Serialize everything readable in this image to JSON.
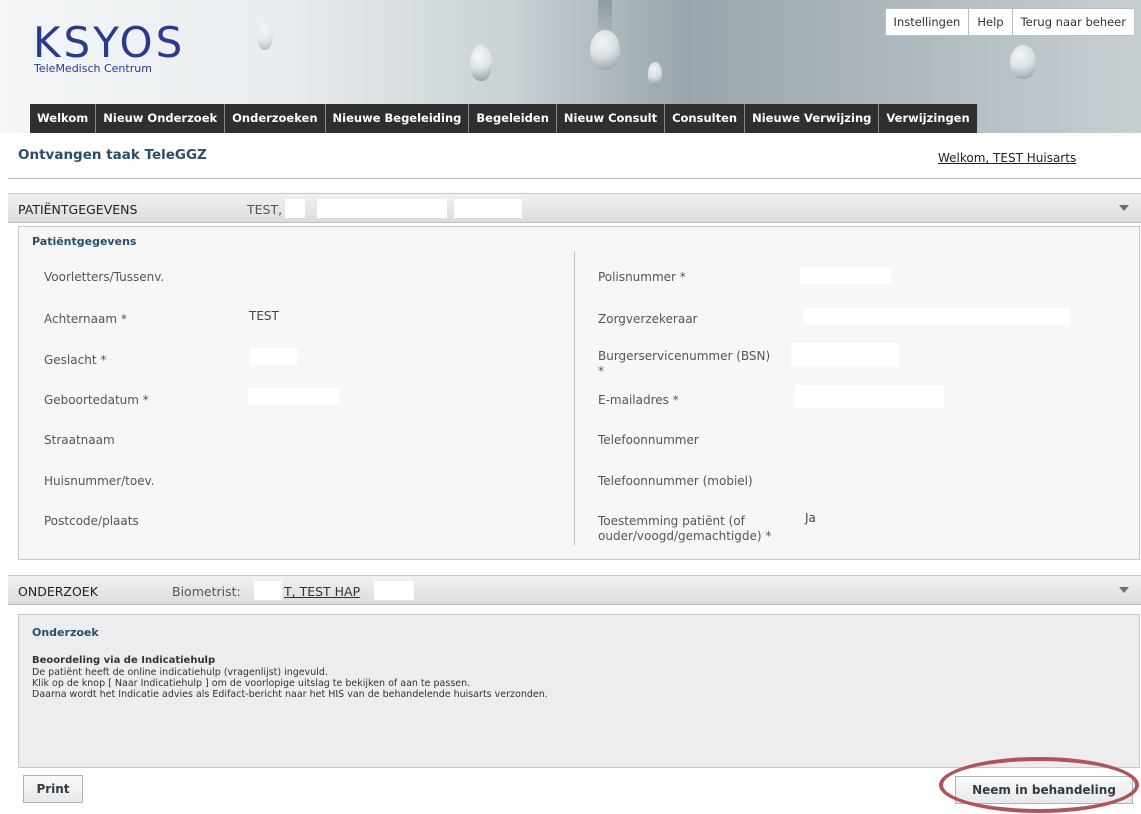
{
  "header": {
    "logo": {
      "main": "KSYOS",
      "sub": "TeleMedisch Centrum"
    },
    "top_links": [
      "Instellingen",
      "Help",
      "Terug naar beheer"
    ]
  },
  "nav": {
    "items": [
      "Welkom",
      "Nieuw Onderzoek",
      "Onderzoeken",
      "Nieuwe Begeleiding",
      "Begeleiden",
      "Nieuw Consult",
      "Consulten",
      "Nieuwe Verwijzing",
      "Verwijzingen"
    ]
  },
  "page": {
    "title": "Ontvangen taak TeleGGZ",
    "welcome": "Welkom, TEST Huisarts"
  },
  "patient_section": {
    "bar_title": "PATIËNTGEGEVENS",
    "bar_name": "TEST,",
    "heading": "Patiëntgegevens",
    "left_fields": [
      {
        "label": "Voorletters/Tussenv.",
        "value": ""
      },
      {
        "label": "Achternaam *",
        "value": "TEST"
      },
      {
        "label": "Geslacht *",
        "value": ""
      },
      {
        "label": "Geboortedatum *",
        "value": ""
      },
      {
        "label": "Straatnaam",
        "value": ""
      },
      {
        "label": "Huisnummer/toev.",
        "value": ""
      },
      {
        "label": "Postcode/plaats",
        "value": ""
      }
    ],
    "right_fields": [
      {
        "label": "Polisnummer *",
        "value": ""
      },
      {
        "label": "Zorgverzekeraar",
        "value": ""
      },
      {
        "label": "Burgerservicenummer (BSN) *",
        "value": ""
      },
      {
        "label": "E-mailadres *",
        "value": ""
      },
      {
        "label": "Telefoonnummer",
        "value": ""
      },
      {
        "label": "Telefoonnummer (mobiel)",
        "value": ""
      },
      {
        "label": "Toestemming patiënt (of ouder/voogd/gemachtigde) *",
        "value": "Ja"
      }
    ]
  },
  "onderzoek_section": {
    "bar_title": "ONDERZOEK",
    "biometrist_label": "Biometrist:",
    "biometrist_name": "T, TEST HAP",
    "heading": "Onderzoek",
    "subheading": "Beoordeling via de Indicatiehulp",
    "lines": [
      "De patiënt heeft de online indicatiehulp (vragenlijst) ingevuld.",
      "Klik op de knop [ Naar Indicatiehulp ] om de voorlopige uitslag te bekijken of aan te passen.",
      "Daarna wordt het Indicatie advies als Edifact-bericht naar het HIS van de behandelende huisarts verzonden."
    ]
  },
  "buttons": {
    "print": "Print",
    "take": "Neem in behandeling"
  },
  "colors": {
    "nav_bg": "#2f2f2f",
    "title": "#2a4d6e",
    "logo": "#2a3a8f",
    "highlight": "#b0545a"
  }
}
